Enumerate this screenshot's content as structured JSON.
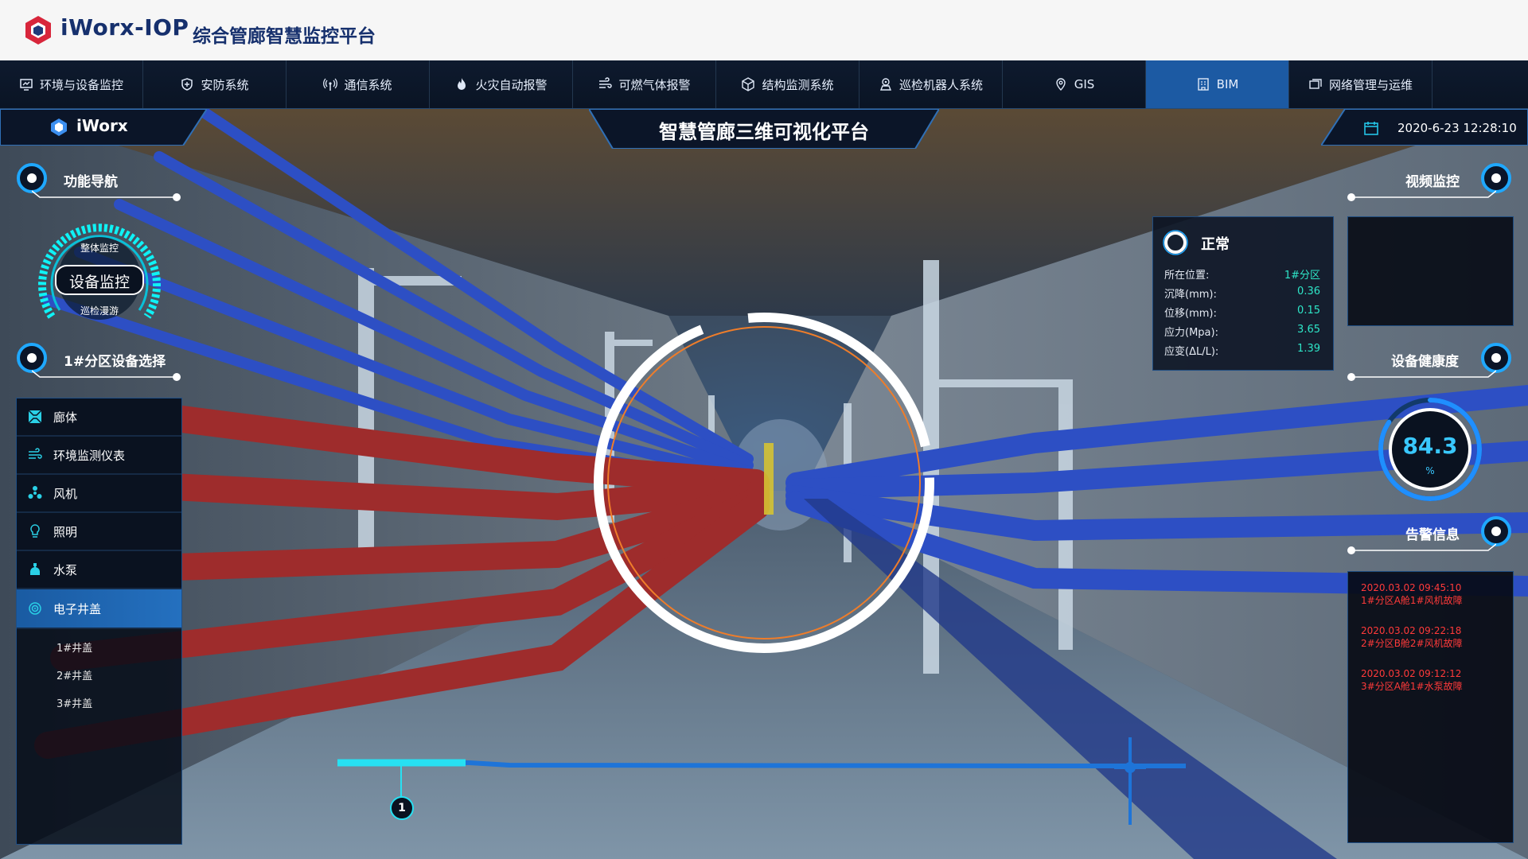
{
  "app": {
    "brand": "iWorx-IOP",
    "subtitle": "综合管廊智慧监控平台"
  },
  "nav": [
    {
      "label": "环境与设备监控",
      "icon": "monitor-icon",
      "active": false
    },
    {
      "label": "安防系统",
      "icon": "shield-icon",
      "active": false
    },
    {
      "label": "通信系统",
      "icon": "signal-icon",
      "active": false
    },
    {
      "label": "火灾自动报警",
      "icon": "fire-icon",
      "active": false
    },
    {
      "label": "可燃气体报警",
      "icon": "gas-icon",
      "active": false
    },
    {
      "label": "结构监测系统",
      "icon": "cube-icon",
      "active": false
    },
    {
      "label": "巡检机器人系统",
      "icon": "robot-icon",
      "active": false
    },
    {
      "label": "GIS",
      "icon": "map-pin-icon",
      "active": false
    },
    {
      "label": "BIM",
      "icon": "building-icon",
      "active": true
    },
    {
      "label": "网络管理与运维",
      "icon": "network-icon",
      "active": false
    }
  ],
  "header": {
    "left_logo": "iWorx",
    "center_title": "智慧管廊三维可视化平台",
    "datetime": "2020-6-23 12:28:10"
  },
  "left": {
    "nav_title": "功能导航",
    "dial": {
      "top": "整体监控",
      "center": "设备监控",
      "bottom": "巡检漫游"
    },
    "section_title": "1#分区设备选择",
    "menu": [
      {
        "label": "廊体",
        "icon": "corridor-icon",
        "active": false
      },
      {
        "label": "环境监测仪表",
        "icon": "wind-lines-icon",
        "active": false
      },
      {
        "label": "风机",
        "icon": "fan-icon",
        "active": false
      },
      {
        "label": "照明",
        "icon": "bulb-icon",
        "active": false
      },
      {
        "label": "水泵",
        "icon": "pump-icon",
        "active": false
      },
      {
        "label": "电子井盖",
        "icon": "manhole-icon",
        "active": true
      }
    ],
    "subitems": [
      "1#井盖",
      "2#井盖",
      "3#井盖"
    ]
  },
  "status": {
    "state": "正常",
    "rows": [
      {
        "label": "所在位置:",
        "value": "1#分区"
      },
      {
        "label": "沉降(mm):",
        "value": "0.36"
      },
      {
        "label": "位移(mm):",
        "value": "0.15"
      },
      {
        "label": "应力(Mpa):",
        "value": "3.65"
      },
      {
        "label": "应变(ΔL/L):",
        "value": "1.39"
      }
    ]
  },
  "right": {
    "video_title": "视频监控",
    "health_title": "设备健康度",
    "health_value": "84.3",
    "health_unit": "%",
    "health_fraction": 0.843,
    "alarm_title": "告警信息",
    "alarms": [
      {
        "time": "2020.03.02 09:45:10",
        "text": "1#分区A舱1#风机故障"
      },
      {
        "time": "2020.03.02 09:22:18",
        "text": "2#分区B舱2#风机故障"
      },
      {
        "time": "2020.03.02 09:12:12",
        "text": "3#分区A舱1#水泵故障"
      }
    ]
  },
  "route": {
    "marker": "1"
  },
  "colors": {
    "accent": "#1c5aa3",
    "cyan": "#19d3e6",
    "alarm": "#ff3a3a",
    "brand": "#16306d"
  }
}
